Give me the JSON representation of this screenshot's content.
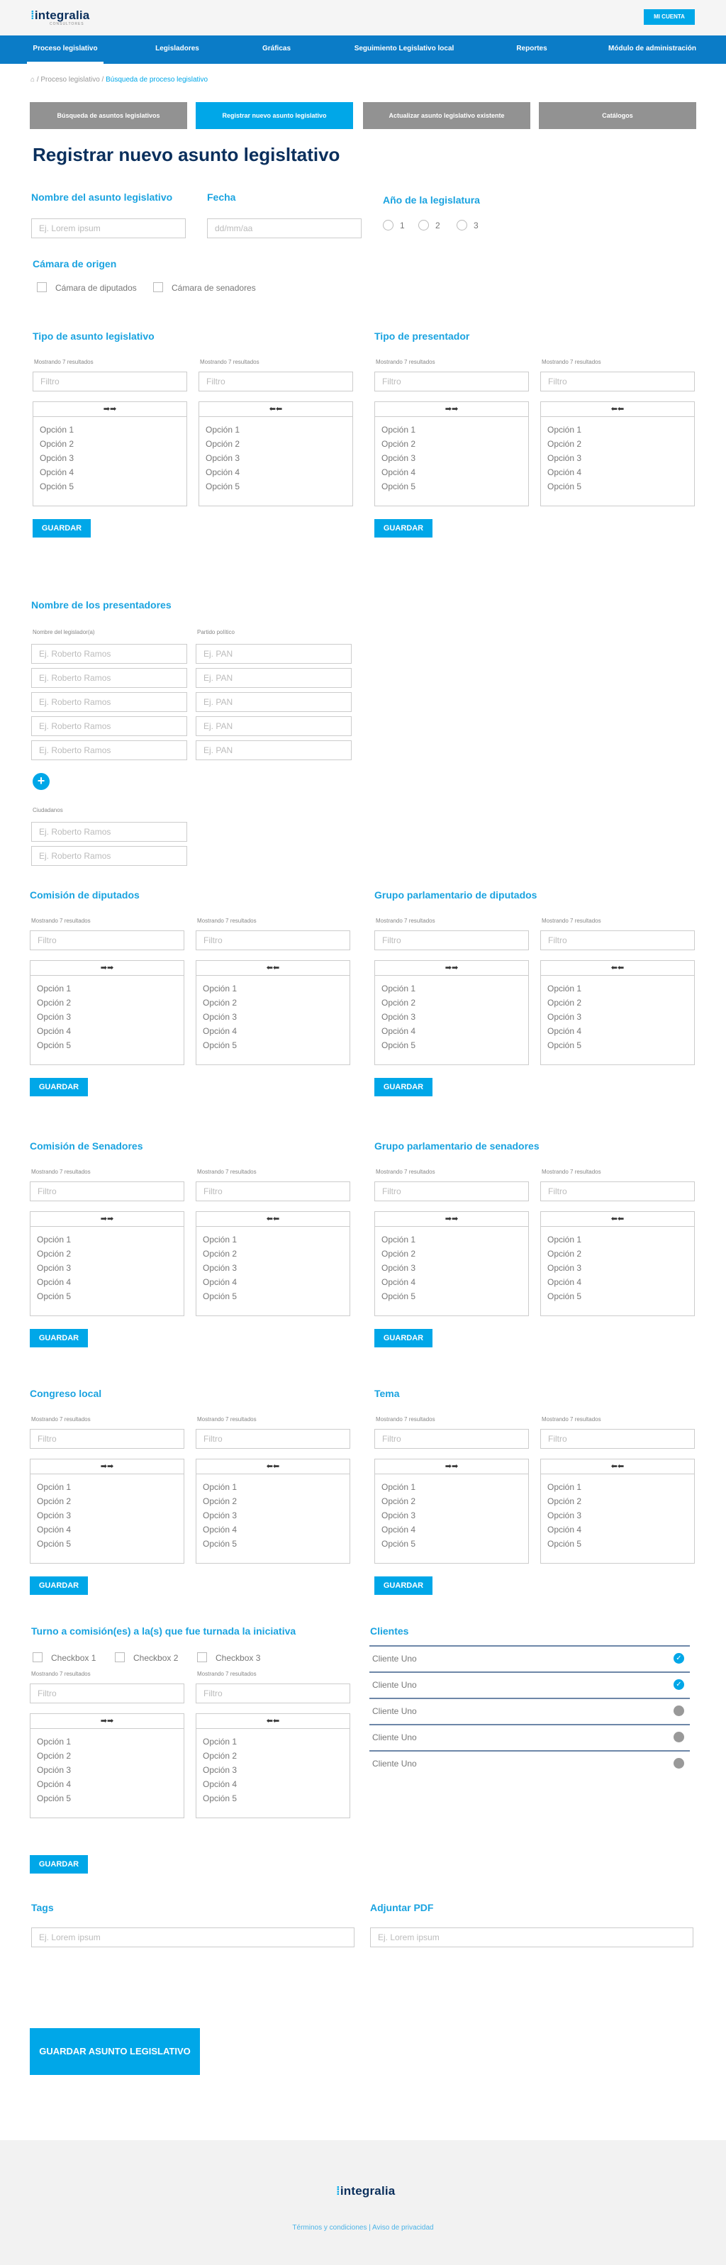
{
  "header": {
    "logo_text": "integralia",
    "logo_sub": "CONSULTORES",
    "account_label": "MI CUENTA"
  },
  "nav": {
    "items": [
      "Proceso legislativo",
      "Legisladores",
      "Gráficas",
      "Seguimiento Legislativo local",
      "Reportes",
      "Módulo de administración"
    ]
  },
  "breadcrumb": {
    "home": "⌂",
    "level1": "/ Proceso legislativo /",
    "current": "Búsqueda de proceso legislativo"
  },
  "subtabs": [
    "Búsqueda de asuntos legislativos",
    "Registrar nuevo asunto legislativo",
    "Actualizar asunto legislativo existente",
    "Catálogos"
  ],
  "page": {
    "title": "Registrar nuevo asunto legisltativo"
  },
  "form": {
    "name_label": "Nombre del asunto legislativo",
    "name_placeholder": "Ej. Lorem ipsum",
    "date_label": "Fecha",
    "date_placeholder": "dd/mm/aa",
    "year_label": "Año de la legislatura",
    "year_options": [
      "1",
      "2",
      "3"
    ],
    "chamber_label": "Cámara de origen",
    "chamber_options": [
      "Cámara de diputados",
      "Cámara de senadores"
    ]
  },
  "common": {
    "showing": "Mostrando 7 resultados",
    "filter_placeholder": "Filtro",
    "arrows_right": "➡➡",
    "arrows_left": "⬅⬅",
    "options": [
      "Opción 1",
      "Opción 2",
      "Opción 3",
      "Opción 4",
      "Opción 5"
    ],
    "save": "GUARDAR"
  },
  "sections": {
    "tipo_asunto": "Tipo de asunto legislativo",
    "tipo_presentador": "Tipo de presentador",
    "comision_diputados": "Comisión de diputados",
    "grupo_diputados": "Grupo parlamentario de diputados",
    "comision_senadores": "Comisión de Senadores",
    "grupo_senadores": "Grupo parlamentario de senadores",
    "congreso_local": "Congreso local",
    "tema": "Tema",
    "turno": "Turno a comisión(es) a la(s) que fue turnada la iniciativa",
    "clientes": "Clientes",
    "tags": "Tags",
    "pdf": "Adjuntar PDF"
  },
  "presenters": {
    "title": "Nombre de los presentadores",
    "name_col": "Nombre del legislador(a)",
    "party_col": "Partido político",
    "name_placeholder": "Ej. Roberto Ramos",
    "party_placeholder": "Ej. PAN",
    "add": "+",
    "citizens_label": "Ciudadanos"
  },
  "turno_checks": [
    "Checkbox 1",
    "Checkbox 2",
    "Checkbox 3"
  ],
  "clients": [
    {
      "name": "Cliente Uno",
      "checked": true
    },
    {
      "name": "Cliente Uno",
      "checked": true
    },
    {
      "name": "Cliente Uno",
      "checked": false
    },
    {
      "name": "Cliente Uno",
      "checked": false
    },
    {
      "name": "Cliente Uno",
      "checked": false
    }
  ],
  "tags_placeholder": "Ej. Lorem ipsum",
  "pdf_placeholder": "Ej. Lorem ipsum",
  "submit": "GUARDAR ASUNTO LEGISLATIVO",
  "footer": {
    "logo_text": "integralia",
    "links": "Términos y condiciones | Aviso de privacidad"
  },
  "colors": {
    "accent": "#00a7e8",
    "nav": "#0b7cc7",
    "title": "#0a2f5c"
  }
}
